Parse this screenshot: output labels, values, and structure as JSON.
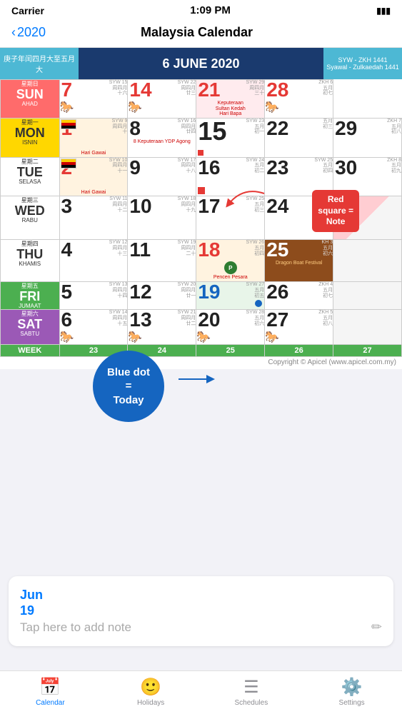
{
  "status": {
    "carrier": "Carrier",
    "time": "1:09 PM",
    "battery": "100%"
  },
  "nav": {
    "back": "2020",
    "title": "Malaysia Calendar"
  },
  "calendar": {
    "header_chinese": "庚子年闰四月大至五月大",
    "header_date": "6 JUNE 2020",
    "header_syawwal": "SYW - ZKH 1441\nSyawal - Zulkaedah 1441",
    "days": [
      {
        "zh": "星期日",
        "en": "SUN",
        "malay": "AHAD",
        "type": "sun"
      },
      {
        "zh": "星期一",
        "en": "MON",
        "malay": "ISNIN",
        "type": "mon"
      },
      {
        "zh": "星期二",
        "en": "TUE",
        "malay": "SELASA",
        "type": "tue"
      },
      {
        "zh": "星期三",
        "en": "WED",
        "malay": "RABU",
        "type": "wed"
      },
      {
        "zh": "星期四",
        "en": "THU",
        "malay": "KHAMIS",
        "type": "thu"
      },
      {
        "zh": "星期五",
        "en": "FRI",
        "malay": "JUMAAT",
        "type": "fri"
      },
      {
        "zh": "星期六",
        "en": "SAT",
        "malay": "SABTU",
        "type": "sat"
      }
    ],
    "weeks": [
      {
        "label": "WEEK",
        "nums": [
          "23",
          "24",
          "25",
          "26",
          "27"
        ]
      }
    ],
    "tooltip_red": "Red\nsquare =\nNote",
    "tooltip_blue": "Blue dot =\nToday",
    "copyright": "Copyright © Apicel (www.apicel.com.my)"
  },
  "note": {
    "date_month": "Jun",
    "date_day": "19",
    "placeholder": "Tap here to add note",
    "edit_icon": "✏️"
  },
  "tabs": [
    {
      "label": "Calendar",
      "icon": "📅",
      "active": true
    },
    {
      "label": "Holidays",
      "icon": "🙂",
      "active": false
    },
    {
      "label": "Schedules",
      "icon": "☰",
      "active": false
    },
    {
      "label": "Settings",
      "icon": "⚙️",
      "active": false
    }
  ]
}
